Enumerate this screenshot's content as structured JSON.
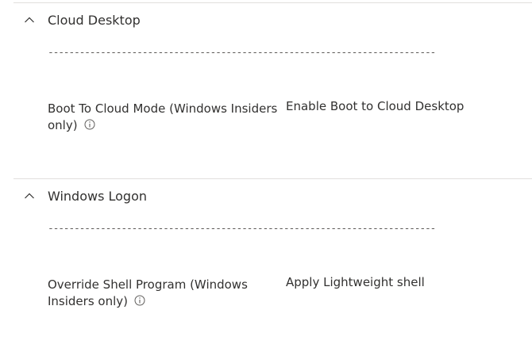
{
  "sections": [
    {
      "title": "Cloud Desktop",
      "divider": "--------------------------------------------------------------------------",
      "setting_label": "Boot To Cloud Mode (Windows Insiders only)",
      "setting_value": "Enable Boot to Cloud Desktop",
      "expanded": true
    },
    {
      "title": "Windows Logon",
      "divider": "--------------------------------------------------------------------------",
      "setting_label": "Override Shell Program (Windows Insiders only)",
      "setting_value": "Apply Lightweight shell",
      "expanded": true
    }
  ],
  "icons": {
    "collapse": "chevron-up-icon",
    "info": "info-icon"
  },
  "colors": {
    "text": "#323130",
    "border": "#e1dfdd",
    "divider": "#605e5c"
  }
}
